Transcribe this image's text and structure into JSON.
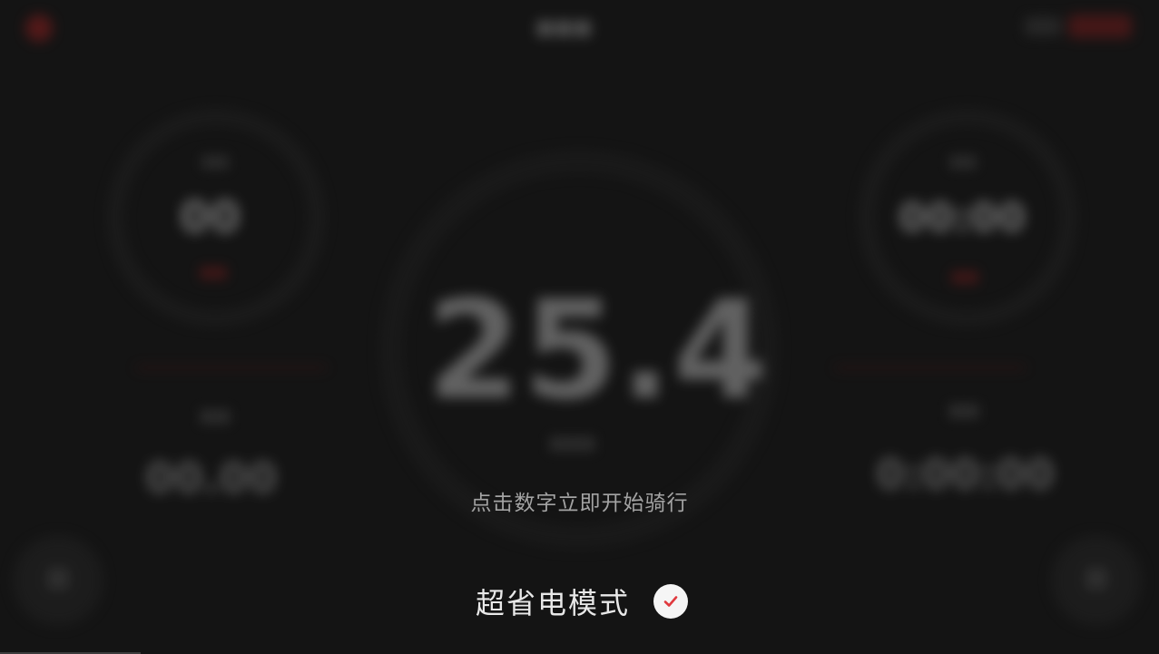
{
  "background": {
    "main_value": "25.4",
    "left_gauge_value": "00",
    "right_gauge_value": "00:00",
    "left_stat_value": "00.00",
    "right_stat_value": "0:00:00"
  },
  "overlay": {
    "hint": "点击数字立即开始骑行",
    "mode_label": "超省电模式",
    "mode_checked": true
  },
  "colors": {
    "accent": "#e0393e",
    "background": "#141414",
    "text_primary": "#e8e8e8",
    "text_secondary": "#a3a3a3"
  },
  "icons": {
    "mode_check": "check-icon"
  }
}
